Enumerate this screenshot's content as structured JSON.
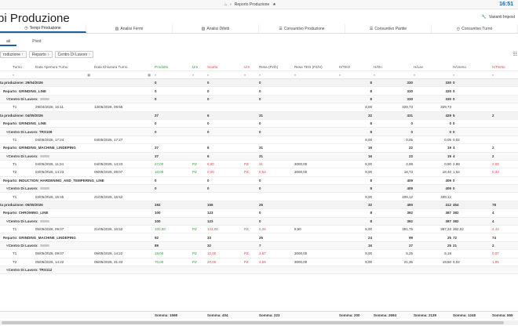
{
  "topbar": {
    "breadcrumb": "Reporto Produzione",
    "clock": "16:51"
  },
  "page": {
    "title": "pi Produzione",
    "varianti": "Varianti Impost"
  },
  "tabs": [
    {
      "label": "Tempi Produzione",
      "icon": "clock-icon",
      "active": true
    },
    {
      "label": "Analisi Fermi",
      "icon": "chart-icon"
    },
    {
      "label": "Analisi Difetti",
      "icon": "chart-icon"
    },
    {
      "label": "Consuntivo Produzione",
      "icon": "list-icon"
    },
    {
      "label": "Consuntivo Partite",
      "icon": "list-icon"
    },
    {
      "label": "Consuntivo Turno",
      "icon": "clock-icon"
    }
  ],
  "subtabs": [
    {
      "label": "ati",
      "active": true
    },
    {
      "label": "Pivot"
    }
  ],
  "groupby": [
    {
      "label": "roduzione"
    },
    {
      "label": "Reparto"
    },
    {
      "label": "Centro Di Lavoro"
    }
  ],
  "columns": [
    "Turno",
    "Data Apertura Turno",
    "Data Chiusura Turno",
    "Prodotto",
    "Um",
    "Scarto",
    "Um",
    "Resa (Pz/h)",
    "Resa TEO (Pz/H)",
    "H/TEO",
    "H/On",
    "H/Lav",
    "H/Uomo",
    "H/Perso"
  ],
  "rows": [
    {
      "type": "g0",
      "label": "ta produzione: 29/04/2026",
      "prod": "0",
      "scarto": "0",
      "resa": "0",
      "hteo": "8",
      "hon": "330",
      "hlav": "330",
      "huomo": "0"
    },
    {
      "type": "g1",
      "label": "Reparto: GRINDING_LINE",
      "prod": "0",
      "scarto": "0",
      "resa": "0",
      "hteo": "8",
      "hon": "330",
      "hlav": "330",
      "huomo": "0"
    },
    {
      "type": "g2",
      "label": "Centro Di Lavoro:",
      "blur": true,
      "prod": "0",
      "scarto": "0",
      "resa": "0",
      "hteo": "8",
      "hon": "330",
      "hlav": "330",
      "huomo": "0"
    },
    {
      "type": "d",
      "turno": "T1",
      "open": "29/04/2026, 15:11",
      "close": "13/05/2026, 08:55",
      "hteo": "8,00",
      "hon": "329,73",
      "hlav": "329,73"
    },
    {
      "type": "g0",
      "label": "ta produzione: 04/05/2026",
      "prod": "37",
      "scarto": "6",
      "resa": "31",
      "hteo": "32",
      "hon": "431",
      "hlav": "429",
      "huomo": "5",
      "hperso": "2"
    },
    {
      "type": "g1",
      "label": "Reparto: GRINDING_LINE",
      "prod": "0",
      "scarto": "0",
      "resa": "0",
      "hteo": "8",
      "hon": "0",
      "hlav": "0",
      "huomo": "0"
    },
    {
      "type": "g2",
      "label": "Centro Di Lavoro: TRS109",
      "prod": "0",
      "scarto": "0",
      "resa": "0",
      "hteo": "8",
      "hon": "0",
      "hlav": "0",
      "huomo": "0"
    },
    {
      "type": "d",
      "turno": "T1",
      "open": "04/05/2026, 17:24",
      "close": "04/05/2026, 17:27",
      "hteo": "8,00",
      "hon": "0,05",
      "hlav": "0,05",
      "huomo": "0,02"
    },
    {
      "type": "g1",
      "label": "Reparto: GRINDING_MACHINE_LINDEPING",
      "prod": "37",
      "scarto": "6",
      "resa": "31",
      "hteo": "16",
      "hon": "22",
      "hlav": "19",
      "huomo": "4",
      "hperso": "2"
    },
    {
      "type": "g2",
      "label": "Centro Di Lavoro:",
      "blur": true,
      "prod": "37",
      "scarto": "6",
      "resa": "31",
      "hteo": "16",
      "hon": "22",
      "hlav": "19",
      "huomo": "4",
      "hperso": "2"
    },
    {
      "type": "d",
      "turno": "T1",
      "open": "04/05/2026, 11:24",
      "close": "04/05/2026, 14:23",
      "prod": "27,00",
      "um": "PZ",
      "scarto": "6,00",
      "um2": "PZ",
      "resa": "31",
      "teo": "3000,00",
      "hteo": "8,00",
      "hon": "2,98",
      "hlav": "0,90",
      "huomo": "2,98",
      "hperso": "2,08",
      "green": true
    },
    {
      "type": "d",
      "turno": "T2",
      "open": "04/05/2026, 14:23",
      "close": "05/05/2026, 09:07",
      "prod": "10,00",
      "um": "PZ",
      "scarto": "0,00",
      "um2": "PZ",
      "resa": "0,54",
      "teo": "3000,00",
      "hteo": "8,00",
      "hon": "18,73",
      "hlav": "18,40",
      "huomo": "1,52",
      "hperso": "0,33",
      "green": true
    },
    {
      "type": "g1",
      "label": "Reparto: INDUCTION_HARDENING_AND_TEMPERING_LINE",
      "prod": "0",
      "scarto": "0",
      "resa": "0",
      "hteo": "8",
      "hon": "409",
      "hlav": "409",
      "huomo": "0"
    },
    {
      "type": "g2",
      "label": "Centro Di Lavoro:",
      "blur": true,
      "prod": "0",
      "scarto": "0",
      "resa": "0",
      "hteo": "8",
      "hon": "409",
      "hlav": "409",
      "huomo": "0"
    },
    {
      "type": "d",
      "turno": "T1",
      "open": "04/05/2026, 15:45",
      "close": "21/05/2026, 16:52",
      "hteo": "8,00",
      "hon": "409,12",
      "hlav": "409,12"
    },
    {
      "type": "g0",
      "label": "ta produzione: 05/05/2026",
      "prod": "192",
      "scarto": "156",
      "resa": "26",
      "hteo": "32",
      "hon": "490",
      "hlav": "412",
      "huomo": "454",
      "hperso": "78"
    },
    {
      "type": "g1",
      "label": "Reparto: CHROMING_LINE",
      "prod": "100",
      "scarto": "123",
      "resa": "0",
      "hteo": "8",
      "hon": "392",
      "hlav": "387",
      "huomo": "382",
      "hperso": "4"
    },
    {
      "type": "g2",
      "label": "Centro Di Lavoro:",
      "blur": true,
      "prod": "100",
      "scarto": "123",
      "resa": "0",
      "hteo": "8",
      "hon": "392",
      "hlav": "387",
      "huomo": "382",
      "hperso": "4"
    },
    {
      "type": "d",
      "turno": "T1",
      "open": "05/05/2026, 09:07",
      "close": "21/05/2026, 16:52",
      "prod": "100,00",
      "um": "PZ",
      "scarto": "123,00",
      "um2": "PZ",
      "resa": "0,26",
      "teo": "8,50",
      "hteo": "8,00",
      "hon": "391,75",
      "hlav": "387,33",
      "huomo": "382,02",
      "hperso": "4,42",
      "green": true
    },
    {
      "type": "g1",
      "label": "Reparto: GRINDING_MACHINE_LINDEPING",
      "prod": "92",
      "scarto": "33",
      "resa": "26",
      "hteo": "24",
      "hon": "99",
      "hlav": "25",
      "huomo": "72",
      "hperso": "74"
    },
    {
      "type": "g2",
      "label": "Centro Di Lavoro:",
      "blur": true,
      "prod": "89",
      "scarto": "32",
      "resa": "7",
      "hteo": "16",
      "hon": "27",
      "hlav": "25",
      "huomo": "21",
      "hperso": "2"
    },
    {
      "type": "d",
      "turno": "T1",
      "open": "05/05/2026, 09:07",
      "close": "05/05/2026, 14:22",
      "prod": "19,00",
      "um": "PZ",
      "scarto": "12,00",
      "um2": "PZ",
      "resa": "3,67",
      "teo": "3000,00",
      "hteo": "8,00",
      "hon": "5,25",
      "hlav": "5,18",
      "hperso": "0,07",
      "green": true
    },
    {
      "type": "d",
      "turno": "T2",
      "open": "05/05/2026, 14:22",
      "close": "05/05/2026, 21:43",
      "prod": "70,00",
      "um": "PZ",
      "scarto": "20,00",
      "um2": "PZ",
      "resa": "3,59",
      "teo": "3000,00",
      "hteo": "8,00",
      "hon": "21,35",
      "hlav": "19,50",
      "huomo": "0,02",
      "hperso": "1,85",
      "green": true
    },
    {
      "type": "g2",
      "label": "Centro Di Lavoro: TRS112",
      "prod": "",
      "scarto": "",
      "resa": "",
      "hteo": "",
      "hon": "",
      "hlav": "",
      "huomo": ""
    }
  ],
  "totals": {
    "prod": "Somma: 1598",
    "scarto": "Somma: 404",
    "resa": "Somma: 223",
    "hteo": "Somma: 200",
    "hon": "Somma: 2694",
    "hlav": "Somma: 2139",
    "huomo": "Somma: 1248",
    "hperso": "Somma: 555"
  }
}
